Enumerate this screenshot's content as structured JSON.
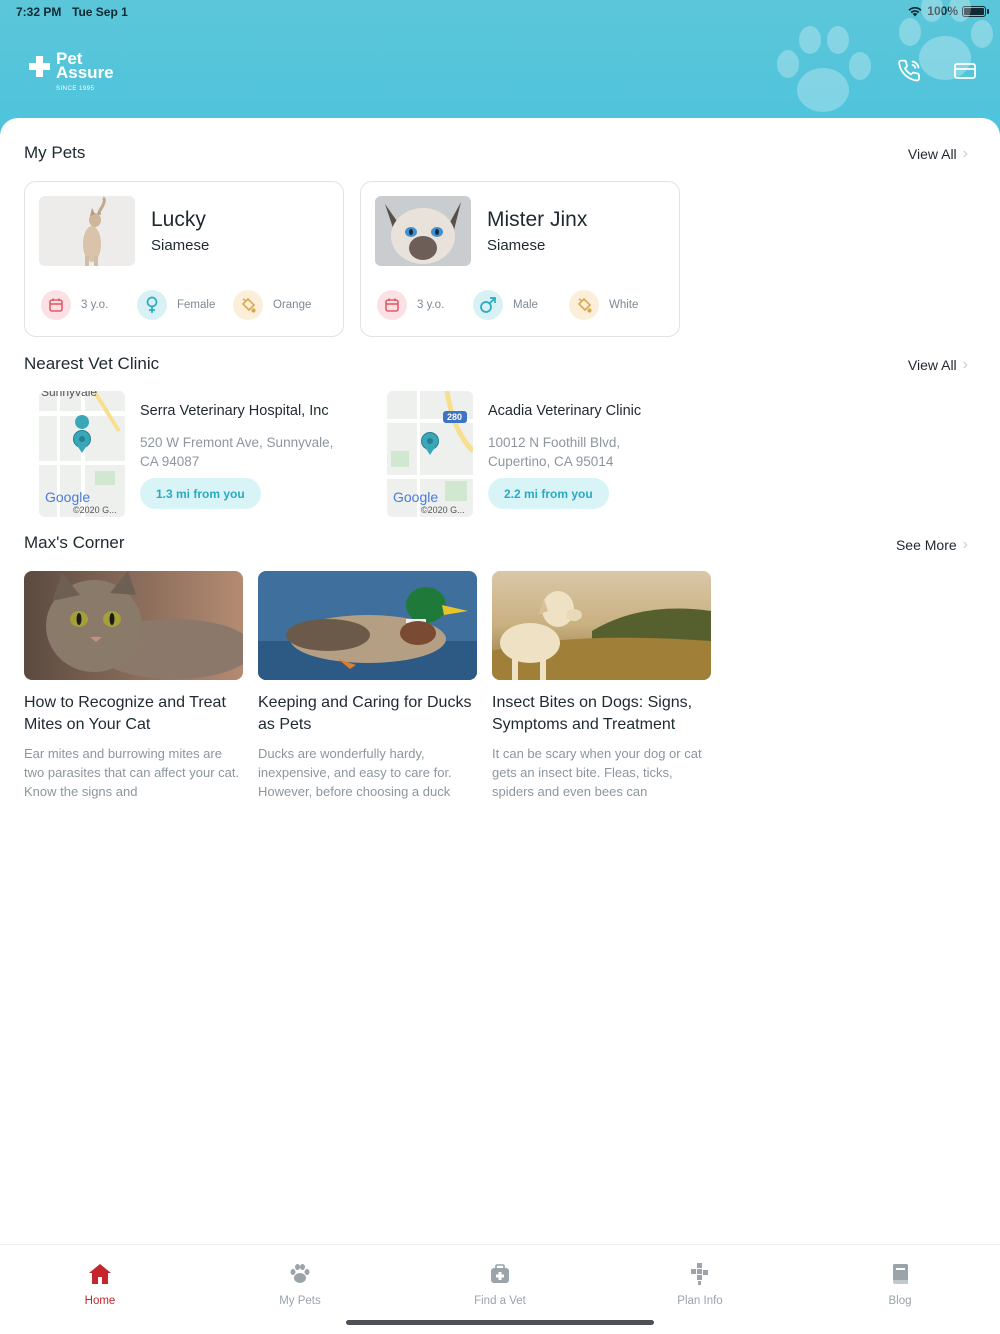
{
  "status_bar": {
    "time": "7:32 PM",
    "date": "Tue Sep 1",
    "battery": "100%"
  },
  "brand": {
    "line1": "Pet",
    "line2": "Assure",
    "tagline": "SINCE 1995"
  },
  "colors": {
    "header": "#4cc3dc",
    "accent": "#c5262d",
    "teal": "#2aa9c2"
  },
  "my_pets": {
    "title": "My Pets",
    "view_all": "View All",
    "pets": [
      {
        "name": "Lucky",
        "breed": "Siamese",
        "age": "3 y.o.",
        "sex": "Female",
        "color": "Orange",
        "sex_icon": "female-icon"
      },
      {
        "name": "Mister Jinx",
        "breed": "Siamese",
        "age": "3 y.o.",
        "sex": "Male",
        "color": "White",
        "sex_icon": "male-icon"
      }
    ]
  },
  "clinics": {
    "title": "Nearest Vet Clinic",
    "view_all": "View All",
    "items": [
      {
        "name": "Serra Veterinary Hospital, Inc",
        "address_line1": "520 W Fremont Ave, Sunnyvale,",
        "address_line2": "CA 94087",
        "distance": "1.3 mi from you",
        "map_label": "Sunnyvale",
        "map_brand": "Google",
        "map_copyright": "©2020 G..."
      },
      {
        "name": "Acadia Veterinary Clinic",
        "address_line1": "10012 N Foothill Blvd,",
        "address_line2": "Cupertino, CA 95014",
        "distance": "2.2 mi from you",
        "map_label": "280",
        "map_brand": "Google",
        "map_copyright": "©2020 G..."
      }
    ]
  },
  "maxs_corner": {
    "title": "Max's Corner",
    "see_more": "See More",
    "articles": [
      {
        "title": "How to Recognize and Treat Mites on Your Cat",
        "desc": "Ear mites and burrowing mites are two parasites that can affect your cat. Know the signs and"
      },
      {
        "title": "Keeping and Caring for Ducks as Pets",
        "desc": "Ducks are wonderfully hardy, inexpensive, and easy to care for. However, before choosing a duck"
      },
      {
        "title": "Insect Bites on Dogs: Signs, Symptoms and Treatment",
        "desc": "It can be scary when your dog or cat gets an insect bite. Fleas, ticks, spiders and even bees can"
      }
    ]
  },
  "tabs": [
    {
      "label": "Home",
      "icon": "home-icon"
    },
    {
      "label": "My Pets",
      "icon": "paw-icon"
    },
    {
      "label": "Find a Vet",
      "icon": "medical-kit-icon"
    },
    {
      "label": "Plan Info",
      "icon": "plan-cross-icon"
    },
    {
      "label": "Blog",
      "icon": "book-icon"
    }
  ]
}
